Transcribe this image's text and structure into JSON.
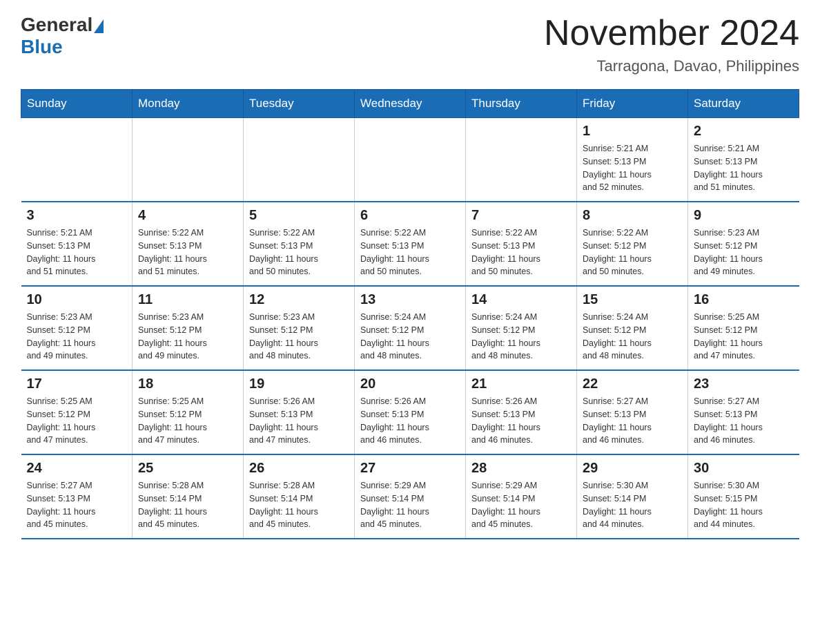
{
  "header": {
    "logo": {
      "general_text": "General",
      "blue_text": "Blue"
    },
    "title": "November 2024",
    "subtitle": "Tarragona, Davao, Philippines"
  },
  "calendar": {
    "weekdays": [
      "Sunday",
      "Monday",
      "Tuesday",
      "Wednesday",
      "Thursday",
      "Friday",
      "Saturday"
    ],
    "weeks": [
      [
        {
          "day": "",
          "info": ""
        },
        {
          "day": "",
          "info": ""
        },
        {
          "day": "",
          "info": ""
        },
        {
          "day": "",
          "info": ""
        },
        {
          "day": "",
          "info": ""
        },
        {
          "day": "1",
          "info": "Sunrise: 5:21 AM\nSunset: 5:13 PM\nDaylight: 11 hours\nand 52 minutes."
        },
        {
          "day": "2",
          "info": "Sunrise: 5:21 AM\nSunset: 5:13 PM\nDaylight: 11 hours\nand 51 minutes."
        }
      ],
      [
        {
          "day": "3",
          "info": "Sunrise: 5:21 AM\nSunset: 5:13 PM\nDaylight: 11 hours\nand 51 minutes."
        },
        {
          "day": "4",
          "info": "Sunrise: 5:22 AM\nSunset: 5:13 PM\nDaylight: 11 hours\nand 51 minutes."
        },
        {
          "day": "5",
          "info": "Sunrise: 5:22 AM\nSunset: 5:13 PM\nDaylight: 11 hours\nand 50 minutes."
        },
        {
          "day": "6",
          "info": "Sunrise: 5:22 AM\nSunset: 5:13 PM\nDaylight: 11 hours\nand 50 minutes."
        },
        {
          "day": "7",
          "info": "Sunrise: 5:22 AM\nSunset: 5:13 PM\nDaylight: 11 hours\nand 50 minutes."
        },
        {
          "day": "8",
          "info": "Sunrise: 5:22 AM\nSunset: 5:12 PM\nDaylight: 11 hours\nand 50 minutes."
        },
        {
          "day": "9",
          "info": "Sunrise: 5:23 AM\nSunset: 5:12 PM\nDaylight: 11 hours\nand 49 minutes."
        }
      ],
      [
        {
          "day": "10",
          "info": "Sunrise: 5:23 AM\nSunset: 5:12 PM\nDaylight: 11 hours\nand 49 minutes."
        },
        {
          "day": "11",
          "info": "Sunrise: 5:23 AM\nSunset: 5:12 PM\nDaylight: 11 hours\nand 49 minutes."
        },
        {
          "day": "12",
          "info": "Sunrise: 5:23 AM\nSunset: 5:12 PM\nDaylight: 11 hours\nand 48 minutes."
        },
        {
          "day": "13",
          "info": "Sunrise: 5:24 AM\nSunset: 5:12 PM\nDaylight: 11 hours\nand 48 minutes."
        },
        {
          "day": "14",
          "info": "Sunrise: 5:24 AM\nSunset: 5:12 PM\nDaylight: 11 hours\nand 48 minutes."
        },
        {
          "day": "15",
          "info": "Sunrise: 5:24 AM\nSunset: 5:12 PM\nDaylight: 11 hours\nand 48 minutes."
        },
        {
          "day": "16",
          "info": "Sunrise: 5:25 AM\nSunset: 5:12 PM\nDaylight: 11 hours\nand 47 minutes."
        }
      ],
      [
        {
          "day": "17",
          "info": "Sunrise: 5:25 AM\nSunset: 5:12 PM\nDaylight: 11 hours\nand 47 minutes."
        },
        {
          "day": "18",
          "info": "Sunrise: 5:25 AM\nSunset: 5:12 PM\nDaylight: 11 hours\nand 47 minutes."
        },
        {
          "day": "19",
          "info": "Sunrise: 5:26 AM\nSunset: 5:13 PM\nDaylight: 11 hours\nand 47 minutes."
        },
        {
          "day": "20",
          "info": "Sunrise: 5:26 AM\nSunset: 5:13 PM\nDaylight: 11 hours\nand 46 minutes."
        },
        {
          "day": "21",
          "info": "Sunrise: 5:26 AM\nSunset: 5:13 PM\nDaylight: 11 hours\nand 46 minutes."
        },
        {
          "day": "22",
          "info": "Sunrise: 5:27 AM\nSunset: 5:13 PM\nDaylight: 11 hours\nand 46 minutes."
        },
        {
          "day": "23",
          "info": "Sunrise: 5:27 AM\nSunset: 5:13 PM\nDaylight: 11 hours\nand 46 minutes."
        }
      ],
      [
        {
          "day": "24",
          "info": "Sunrise: 5:27 AM\nSunset: 5:13 PM\nDaylight: 11 hours\nand 45 minutes."
        },
        {
          "day": "25",
          "info": "Sunrise: 5:28 AM\nSunset: 5:14 PM\nDaylight: 11 hours\nand 45 minutes."
        },
        {
          "day": "26",
          "info": "Sunrise: 5:28 AM\nSunset: 5:14 PM\nDaylight: 11 hours\nand 45 minutes."
        },
        {
          "day": "27",
          "info": "Sunrise: 5:29 AM\nSunset: 5:14 PM\nDaylight: 11 hours\nand 45 minutes."
        },
        {
          "day": "28",
          "info": "Sunrise: 5:29 AM\nSunset: 5:14 PM\nDaylight: 11 hours\nand 45 minutes."
        },
        {
          "day": "29",
          "info": "Sunrise: 5:30 AM\nSunset: 5:14 PM\nDaylight: 11 hours\nand 44 minutes."
        },
        {
          "day": "30",
          "info": "Sunrise: 5:30 AM\nSunset: 5:15 PM\nDaylight: 11 hours\nand 44 minutes."
        }
      ]
    ]
  }
}
